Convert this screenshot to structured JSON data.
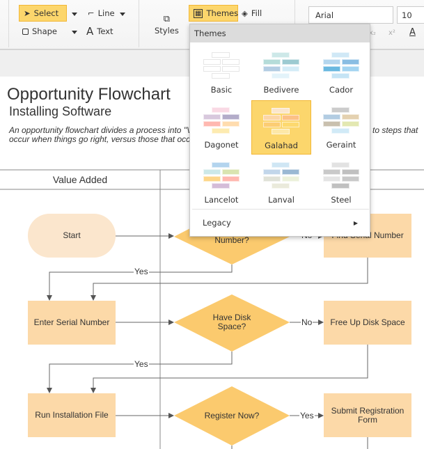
{
  "toolbar": {
    "select": "Select",
    "line": "Line",
    "shape": "Shape",
    "text": "Text",
    "styles": "Styles",
    "themes": "Themes",
    "fill": "Fill",
    "font": "Arial",
    "font_size": "10",
    "subscript": "x₂",
    "superscript": "x²",
    "font_color": "A"
  },
  "themes_menu": {
    "title": "Themes",
    "items": [
      {
        "name": "Basic",
        "colors": [
          "#ffffff",
          "#ffffff",
          "#ffffff",
          "#ffffff",
          "#ffffff",
          "#ffffff"
        ]
      },
      {
        "name": "Bedivere",
        "colors": [
          "#cde8e8",
          "#b5dcd9",
          "#9ccad1",
          "#b3cde3",
          "#d4ecf7",
          "#e3f3fa"
        ]
      },
      {
        "name": "Cador",
        "colors": [
          "#d0e8f6",
          "#b4d6ee",
          "#89bde3",
          "#6ab8e0",
          "#a3d4f1",
          "#c5e4f5"
        ]
      },
      {
        "name": "Dagonet",
        "colors": [
          "#f9d9e4",
          "#d8c8dd",
          "#b3acc9",
          "#ffb8b0",
          "#ffdcae",
          "#fdebb0"
        ]
      },
      {
        "name": "Galahad",
        "colors": [
          "#fbe6cd",
          "#fcd6a8",
          "#fcc186",
          "#fccd73",
          "#fdd96f",
          "#fde8a8"
        ],
        "selected": true
      },
      {
        "name": "Geraint",
        "colors": [
          "#cccccc",
          "#b2cce2",
          "#e4d1b0",
          "#c9c0ae",
          "#e3e8b1",
          "#d1eaf7"
        ]
      },
      {
        "name": "Lancelot",
        "colors": [
          "#b3d4ee",
          "#cce8e8",
          "#d9e4b0",
          "#fdd68a",
          "#ffb8b0",
          "#d4bcd8"
        ]
      },
      {
        "name": "Lanval",
        "colors": [
          "#cfe6f4",
          "#c2d6ea",
          "#9ab8d3",
          "#e0e2d8",
          "#ecf1db",
          "#eaeadb"
        ]
      },
      {
        "name": "Steel",
        "colors": [
          "#e2e2e2",
          "#c9c9c9",
          "#c0c0c0",
          "#e4e4e4",
          "#c9c9c9",
          "#c0c0c0"
        ]
      }
    ],
    "legacy": "Legacy"
  },
  "document": {
    "title": "Opportunity Flowchart",
    "subtitle": "Installing Software",
    "desc_line1_left": "An opportunity flowchart divides a process into \"Va",
    "desc_line1_right": "to steps that",
    "desc_line2_left": "occur when things go right, versus those that occur",
    "lane_value_added": "Value Added"
  },
  "flow": {
    "start": "Start",
    "d1": "Number?",
    "find_serial": "Find Serial Number",
    "enter_serial": "Enter Serial Number",
    "d2": "Have Disk Space?",
    "free_disk": "Free Up Disk Space",
    "run_install": "Run Installation File",
    "d3": "Register Now?",
    "submit_reg": "Submit Registration Form",
    "yes": "Yes",
    "no": "No"
  },
  "colors": {
    "accent": "#fcd66c",
    "process": "#fcd9a8",
    "decision": "#fbca6e",
    "terminator": "#fbe6cd"
  }
}
